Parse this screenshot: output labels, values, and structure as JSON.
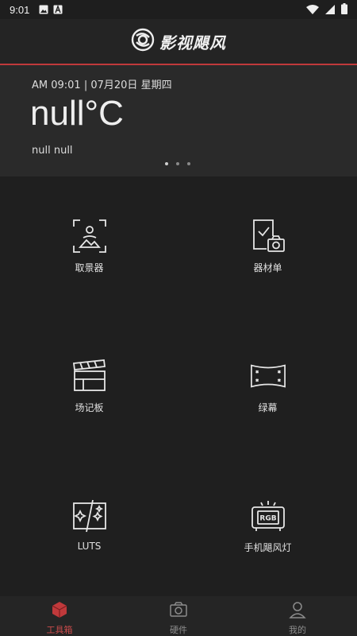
{
  "status_bar": {
    "time": "9:01",
    "icons": [
      "image-icon",
      "a-icon",
      "wifi-icon",
      "signal-icon",
      "battery-icon"
    ]
  },
  "app_bar": {
    "logo_text": "影视飓风"
  },
  "weather": {
    "date_line": "AM 09:01 | 07月20日 星期四",
    "temperature": "null°C",
    "condition": "null null",
    "carousel": {
      "pages": 3,
      "active_index": 0
    }
  },
  "tools": [
    {
      "label": "取景器",
      "icon": "viewfinder-icon"
    },
    {
      "label": "器材单",
      "icon": "equipment-list-icon"
    },
    {
      "label": "场记板",
      "icon": "clapperboard-icon"
    },
    {
      "label": "绿幕",
      "icon": "green-screen-icon"
    },
    {
      "label": "LUTS",
      "icon": "luts-icon"
    },
    {
      "label": "手机飓风灯",
      "icon": "rgb-light-icon"
    }
  ],
  "bottom_nav": [
    {
      "label": "工具箱",
      "icon": "toolbox-icon",
      "active": true
    },
    {
      "label": "硬件",
      "icon": "camera-icon",
      "active": false
    },
    {
      "label": "我的",
      "icon": "person-icon",
      "active": false
    }
  ],
  "colors": {
    "accent": "#c0393b",
    "background": "#1f1f1f",
    "panel": "#2a2a2a"
  }
}
